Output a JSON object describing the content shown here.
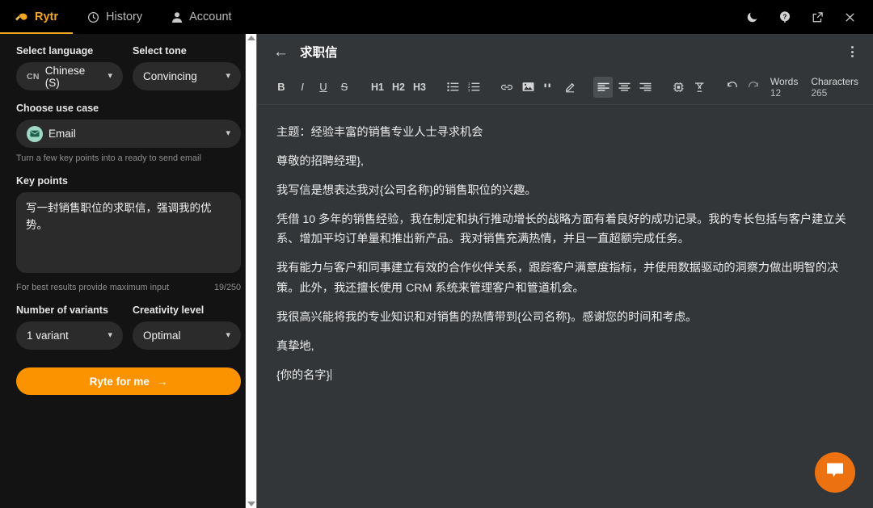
{
  "topbar": {
    "tabs": [
      {
        "label": "Rytr",
        "icon": "rytr-logo-icon",
        "active": true
      },
      {
        "label": "History",
        "icon": "clock-icon",
        "active": false
      },
      {
        "label": "Account",
        "icon": "user-icon",
        "active": false
      }
    ],
    "window_buttons": [
      {
        "name": "dark-mode-toggle",
        "icon": "moon-icon"
      },
      {
        "name": "help-button",
        "icon": "question-circle-icon"
      },
      {
        "name": "open-external-button",
        "icon": "external-link-icon"
      },
      {
        "name": "close-button",
        "icon": "close-icon"
      }
    ]
  },
  "sidebar": {
    "language": {
      "label": "Select language",
      "flag": "CN",
      "value": "Chinese (S)"
    },
    "tone": {
      "label": "Select tone",
      "value": "Convincing"
    },
    "use_case": {
      "label": "Choose use case",
      "value": "Email",
      "icon": "email-envelope-icon",
      "hint": "Turn a few key points into a ready to send email"
    },
    "key_points": {
      "label": "Key points",
      "value": "写一封销售职位的求职信，强调我的优势。",
      "placeholder": "",
      "hint": "For best results provide maximum input",
      "counter": "19/250"
    },
    "variants": {
      "label": "Number of variants",
      "value": "1 variant"
    },
    "creativity": {
      "label": "Creativity level",
      "value": "Optimal"
    },
    "cta": {
      "label": "Ryte for me",
      "arrow": "→",
      "color": "#fb9200"
    }
  },
  "editor": {
    "title": "求职信",
    "back_icon": "arrow-left-icon",
    "menu_icon": "more-vertical-icon",
    "toolbar": {
      "bold": "B",
      "italic": "I",
      "underline": "U",
      "strike": "S",
      "h1": "H1",
      "h2": "H2",
      "h3": "H3",
      "bullet_list": "bullet-list-icon",
      "numbered_list": "numbered-list-icon",
      "link": "link-icon",
      "image": "image-icon",
      "quote": "quote-icon",
      "highlight": "highlight-pen-icon",
      "align_left": "align-left-icon",
      "align_center": "align-center-icon",
      "align_right": "align-right-icon",
      "plugin": "plugin-icon",
      "clear_format": "clear-formatting-icon",
      "undo": "undo-icon",
      "redo": "redo-icon"
    },
    "counters": {
      "words_label": "Words",
      "words_value": "12",
      "characters_label": "Characters",
      "characters_value": "265"
    },
    "paragraphs": [
      "主题：经验丰富的销售专业人士寻求机会",
      "尊敬的招聘经理},",
      "我写信是想表达我对{公司名称}的销售职位的兴趣。",
      "凭借 10 多年的销售经验，我在制定和执行推动增长的战略方面有着良好的成功记录。我的专长包括与客户建立关系、增加平均订单量和推出新产品。我对销售充满热情，并且一直超额完成任务。",
      "我有能力与客户和同事建立有效的合作伙伴关系，跟踪客户满意度指标，并使用数据驱动的洞察力做出明智的决策。此外，我还擅长使用 CRM 系统来管理客户和管道机会。",
      "我很高兴能将我的专业知识和对销售的热情带到{公司名称}。感谢您的时间和考虑。",
      "真挚地,",
      "{你的名字}"
    ]
  },
  "chat_fab": {
    "icon": "chat-bubble-icon",
    "color": "#ec7211"
  }
}
